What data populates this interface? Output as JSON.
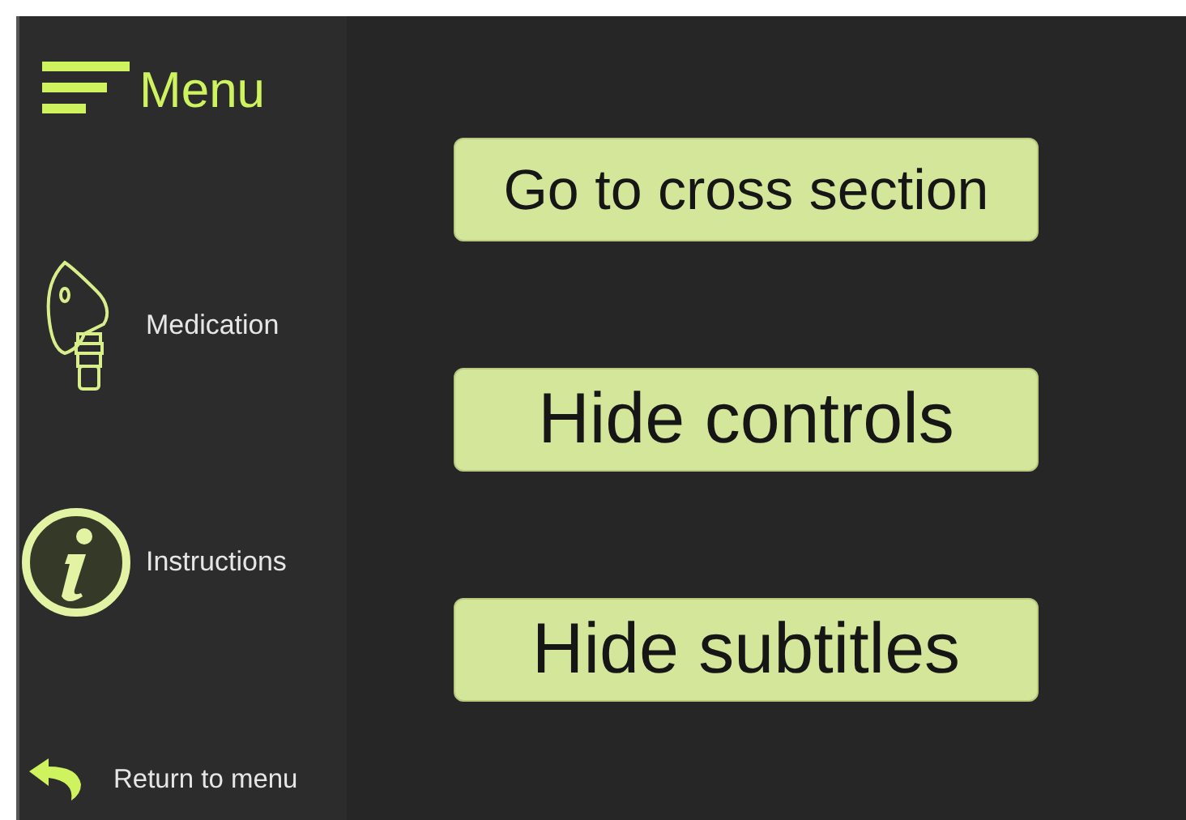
{
  "sidebar": {
    "title": "Menu",
    "items": [
      {
        "label": "Medication"
      },
      {
        "label": "Instructions"
      }
    ],
    "footer": {
      "label": "Return to menu"
    }
  },
  "buttons": [
    {
      "label": "Go to cross section",
      "kind": "long"
    },
    {
      "label": "Hide controls",
      "kind": "short"
    },
    {
      "label": "Hide subtitles",
      "kind": "short"
    }
  ]
}
